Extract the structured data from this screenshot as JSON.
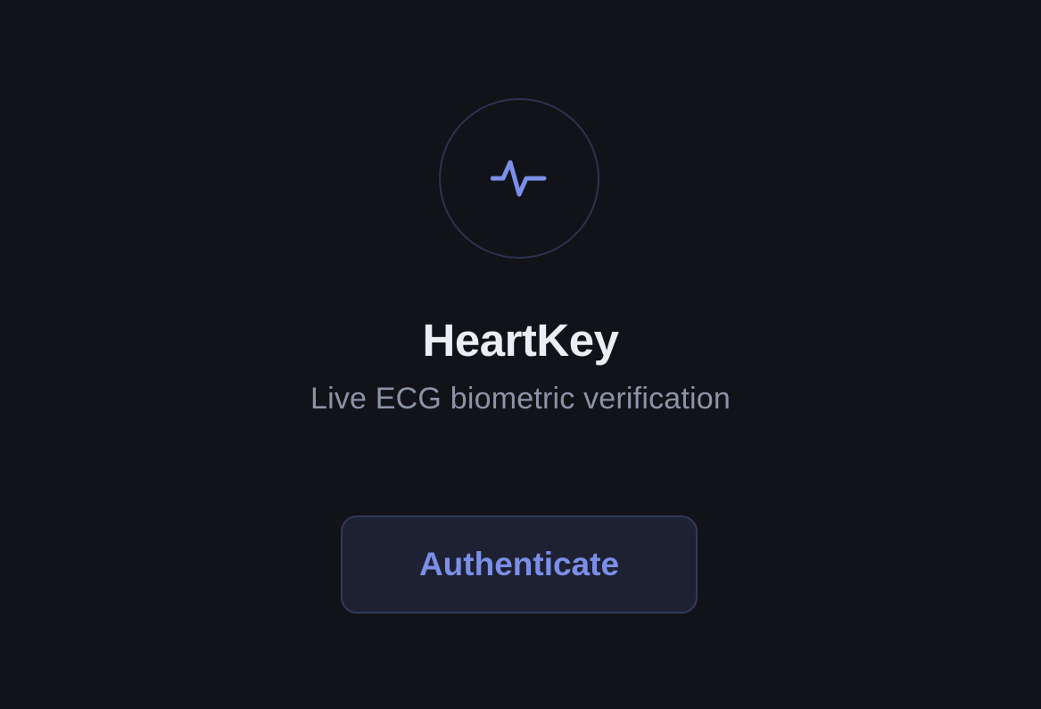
{
  "app": {
    "title": "HeartKey",
    "subtitle": "Live ECG biometric verification"
  },
  "logo": {
    "icon": "heartbeat-pulse-icon",
    "accent_color": "#7b8fe8"
  },
  "actions": {
    "authenticate_label": "Authenticate"
  },
  "colors": {
    "background": "#121318",
    "title": "#eceef3",
    "subtitle": "#8c93a8",
    "button_bg": "#1e2131",
    "button_border": "#323a5c",
    "accent": "#7b8fe8"
  }
}
